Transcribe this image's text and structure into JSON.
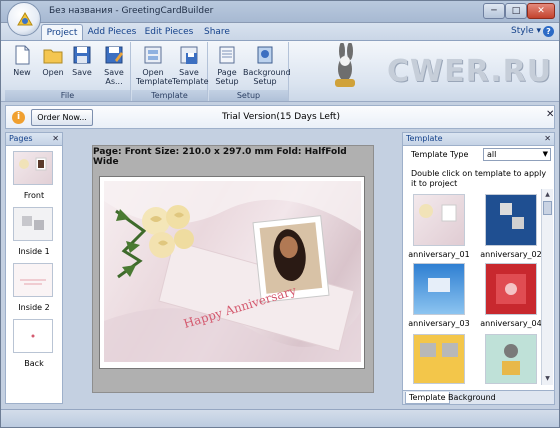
{
  "window": {
    "title": "Без названия - GreetingCardBuilder",
    "min": "─",
    "max": "□",
    "close": "✕"
  },
  "tabs": [
    {
      "label": "Project",
      "active": true
    },
    {
      "label": "Add Pieces",
      "active": false
    },
    {
      "label": "Edit Pieces",
      "active": false
    },
    {
      "label": "Share",
      "active": false
    }
  ],
  "style_label": "Style ▾",
  "help": "?",
  "ribbon": {
    "file": {
      "label": "File",
      "new": "New",
      "open": "Open",
      "save": "Save",
      "save_as_1": "Save",
      "save_as_2": "As..."
    },
    "template": {
      "label": "Template",
      "open_1": "Open",
      "open_2": "Template",
      "save_1": "Save",
      "save_2": "Template"
    },
    "setup": {
      "label": "Setup",
      "page_1": "Page",
      "page_2": "Setup",
      "bg_1": "Background",
      "bg_2": "Setup"
    }
  },
  "logo_text": "CWER.RU",
  "trial": {
    "order_button": "Order Now...",
    "text": "Trial Version(15 Days Left)",
    "close": "✕"
  },
  "pages_panel": {
    "title": "Pages",
    "close": "✕",
    "pages": [
      "Front",
      "Inside 1",
      "Inside 2",
      "Back"
    ]
  },
  "page_info": "Page: Front   Size: 210.0 x 297.0 mm   Fold: HalfFold Wide",
  "card_text": "Happy Anniversary",
  "template_panel": {
    "title": "Template",
    "close": "✕",
    "type_label": "Template Type",
    "type_value": "all",
    "hint": "Double click on template to apply it to project",
    "templates": [
      "anniversary_01",
      "anniversary_02",
      "anniversary_03",
      "anniversary_04"
    ],
    "bottom_tabs": [
      "Template",
      "Background"
    ]
  },
  "colors": {
    "accent": "#15428b",
    "ribbon_bg": "#dbe4f0",
    "close_red": "#c3432e"
  }
}
